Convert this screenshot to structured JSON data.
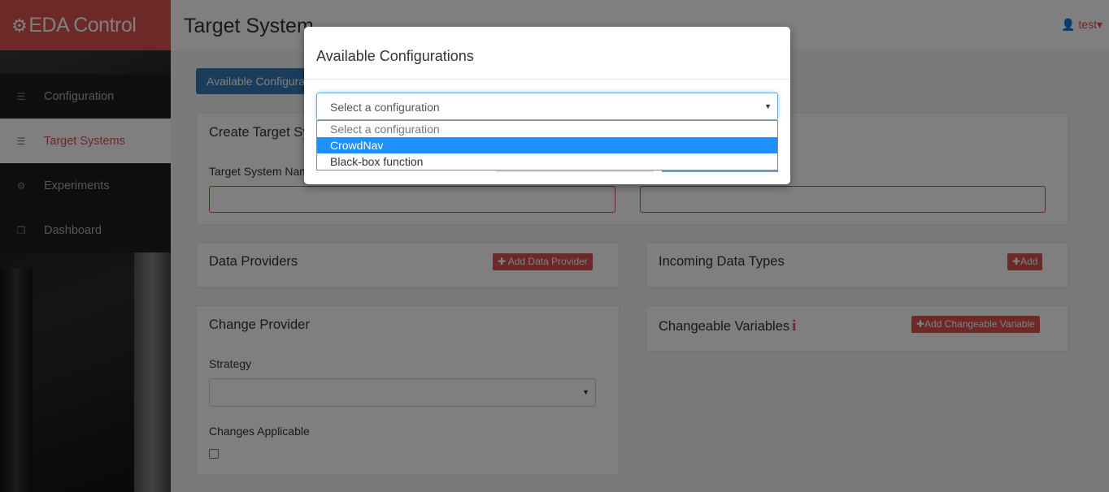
{
  "app": {
    "brand": "EDA Control",
    "page_title": "Target System",
    "user": "test"
  },
  "sidebar": {
    "items": [
      {
        "label": "Configuration",
        "icon": "list-icon"
      },
      {
        "label": "Target Systems",
        "icon": "list-icon",
        "active": true
      },
      {
        "label": "Experiments",
        "icon": "gears-icon"
      },
      {
        "label": "Dashboard",
        "icon": "files-icon"
      }
    ]
  },
  "main": {
    "available_configs_button": "Available Configurations",
    "create_panel": {
      "title": "Create Target System",
      "name_label": "Target System Name"
    },
    "data_providers": {
      "title": "Data Providers",
      "add_button": "Add Data Provider"
    },
    "incoming_types": {
      "title": "Incoming Data Types",
      "add_button": "Add"
    },
    "change_provider": {
      "title": "Change Provider",
      "strategy_label": "Strategy",
      "changes_label": "Changes Applicable"
    },
    "changeable_vars": {
      "title": "Changeable Variables",
      "add_button": "Add Changeable Variable"
    }
  },
  "modal": {
    "title": "Available Configurations",
    "select_value": "Select a configuration",
    "options": [
      "Select a configuration",
      "CrowdNav",
      "Black-box function"
    ],
    "highlighted_option": "CrowdNav"
  },
  "colors": {
    "brand": "#d9534f",
    "primary": "#337ab7",
    "highlight": "#1e90ff"
  }
}
